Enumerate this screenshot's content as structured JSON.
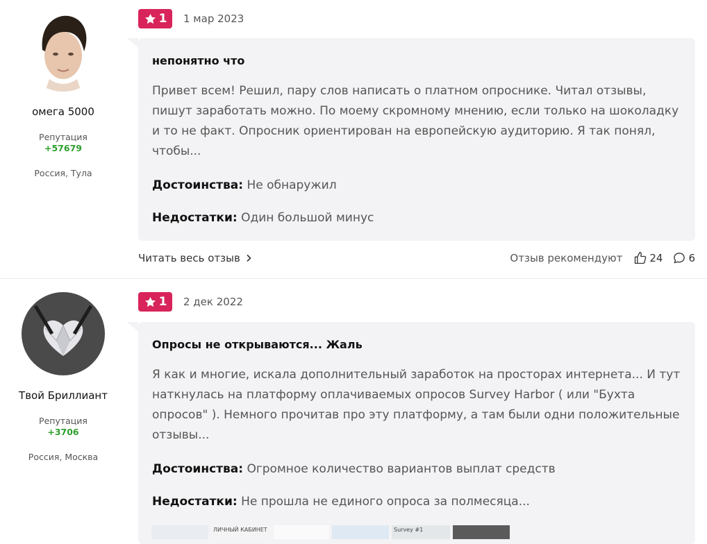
{
  "reviews": [
    {
      "author": {
        "name": "омега 5000",
        "reputation_label": "Репутация",
        "reputation_value": "+57679",
        "location": "Россия, Тула"
      },
      "rating": "1",
      "date": "1 мар 2023",
      "title": "непонятно что",
      "text": "Привет всем! Решил, пару слов написать о платном опроснике. Читал отзывы, пишут заработать можно. По моему скромному мнению, если только на шоколадку и то не факт. Опросник ориентирован на европейскую аудиторию. Я так понял, чтобы...",
      "pros_label": "Достоинства:",
      "pros": "Не обнаружил",
      "cons_label": "Недостатки:",
      "cons": "Один большой минус",
      "read_more": "Читать весь отзыв",
      "recommend_label": "Отзыв рекомендуют",
      "likes": "24",
      "comments": "6"
    },
    {
      "author": {
        "name": "Твой Бриллиант",
        "reputation_label": "Репутация",
        "reputation_value": "+3706",
        "location": "Россия, Москва"
      },
      "rating": "1",
      "date": "2 дек 2022",
      "title": "Опросы не открываются... Жаль",
      "text": "Я как и многие, искала дополнительный заработок на просторах интернета... И тут наткнулась на платформу оплачиваемых опросов Survey Harbor ( или \"Бухта опросов\" ). Немного прочитав про эту платформу, а там были одни положительные отзывы...",
      "pros_label": "Достоинства:",
      "pros": "Огромное количество вариантов выплат средств",
      "cons_label": "Недостатки:",
      "cons": "Не прошла не единого опроса за полмесяца...",
      "thumbnails": [
        "ЛИЧНЫЙ КАБИНЕТ",
        "Survey #1"
      ]
    }
  ],
  "colors": {
    "badge": "#d8245a",
    "card": "#f3f3f5",
    "reputation": "#2e9e2e"
  }
}
